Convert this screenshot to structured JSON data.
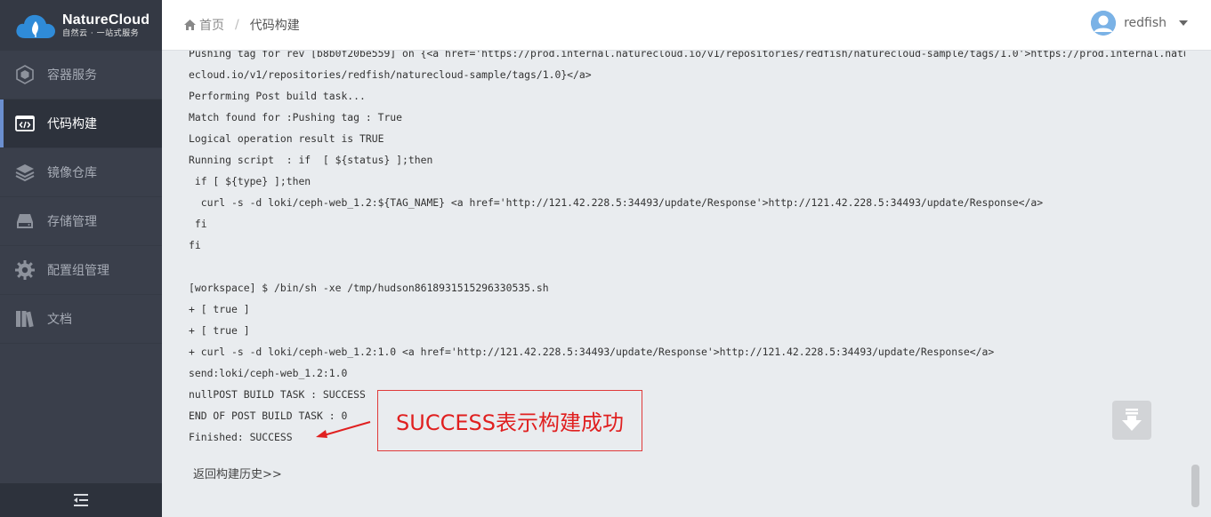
{
  "brand": {
    "title": "NatureCloud",
    "subtitle": "自然云 · 一站式服务",
    "accent": "#2f8bd8"
  },
  "sidebar": {
    "items": [
      {
        "label": "容器服务",
        "icon": "cube-icon",
        "active": false
      },
      {
        "label": "代码构建",
        "icon": "code-icon",
        "active": true
      },
      {
        "label": "镜像仓库",
        "icon": "layers-icon",
        "active": false
      },
      {
        "label": "存储管理",
        "icon": "storage-icon",
        "active": false
      },
      {
        "label": "配置组管理",
        "icon": "gear-icon",
        "active": false
      },
      {
        "label": "文档",
        "icon": "books-icon",
        "active": false
      }
    ],
    "footer_icon": "collapse-menu-icon"
  },
  "header": {
    "breadcrumb": {
      "home": "首页",
      "separator": "/",
      "current": "代码构建"
    },
    "user": {
      "name": "redfish"
    }
  },
  "log": {
    "lines": [
      "Pushing tag for rev [b8b0f20be559] on {<a href='https://prod.internal.naturecloud.io/v1/repositories/redfish/naturecloud-sample/tags/1.0'>https://prod.internal.natur",
      "ecloud.io/v1/repositories/redfish/naturecloud-sample/tags/1.0}</a>",
      "Performing Post build task...",
      "Match found for :Pushing tag : True",
      "Logical operation result is TRUE",
      "Running script  : if  [ ${status} ];then",
      " if [ ${type} ];then",
      "  curl -s -d loki/ceph-web_1.2:${TAG_NAME} <a href='http://121.42.228.5:34493/update/Response'>http://121.42.228.5:34493/update/Response</a>",
      " fi",
      "fi",
      "",
      "[workspace] $ /bin/sh -xe /tmp/hudson8618931515296330535.sh",
      "+ [ true ]",
      "+ [ true ]",
      "+ curl -s -d loki/ceph-web_1.2:1.0 <a href='http://121.42.228.5:34493/update/Response'>http://121.42.228.5:34493/update/Response</a>",
      "send:loki/ceph-web_1.2:1.0",
      "nullPOST BUILD TASK : SUCCESS",
      "END OF POST BUILD TASK : 0",
      "Finished: SUCCESS"
    ],
    "back_link": "返回构建历史>>"
  },
  "annotation": {
    "text": "SUCCESS表示构建成功",
    "color": "#e02020"
  }
}
